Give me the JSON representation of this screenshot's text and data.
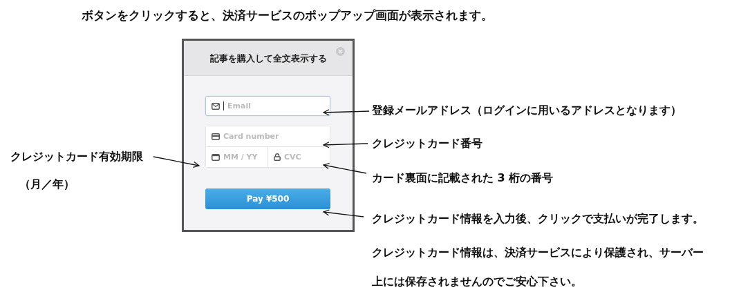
{
  "heading": "ボタンをクリックすると、決済サービスのポップアップ画面が表示されます。",
  "dialog": {
    "title": "記事を購入して全文表示する",
    "fields": [
      {
        "kind": "email",
        "placeholder": "Email",
        "focused": true
      },
      {
        "kind": "card",
        "placeholder": "Card number",
        "focused": false
      },
      {
        "kind": "expiry",
        "placeholder": "MM / YY",
        "focused": false
      },
      {
        "kind": "cvc",
        "placeholder": "CVC",
        "focused": false
      }
    ],
    "pay_button": "Pay ¥500"
  },
  "annotations": [
    {
      "text": "登録メールアドレス（ログインに用いるアドレスとなります）"
    },
    {
      "text": "クレジットカード番号"
    },
    {
      "text": "クレジットカード有効期限"
    },
    {
      "text": "（月／年）"
    },
    {
      "text": "カード裏面に記載された 3 桁の番号"
    },
    {
      "text": "クレジットカード情報を入力後、クリックで支払いが完了します。"
    },
    {
      "text": "クレジットカード情報は、決済サービスにより保護され、サーバー上には保存されませんのでご安心下さい。"
    }
  ]
}
